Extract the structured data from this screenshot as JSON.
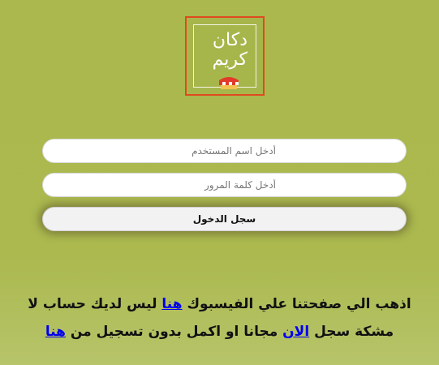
{
  "logo": {
    "line1": "دكان",
    "line2": "كريم"
  },
  "form": {
    "username_placeholder": "أدخل اسم المستخدم",
    "password_placeholder": "أدخل كلمة المرور",
    "login_label": "سجل الدخول"
  },
  "info": {
    "line1_text": "اذهب الي صفحتنا علي الفيسبوك",
    "line1_link": "هنا",
    "line1_text2": " ليس لديك حساب لا",
    "line2_text": "مشكة سجل",
    "line2_link1": "الان",
    "line2_text2": "مجانا او اكمل بدون تسجيل من",
    "line2_link2": "هنا"
  },
  "colors": {
    "background": "#aab84d",
    "logo_border": "#e04a20",
    "link": "#0000ee"
  }
}
